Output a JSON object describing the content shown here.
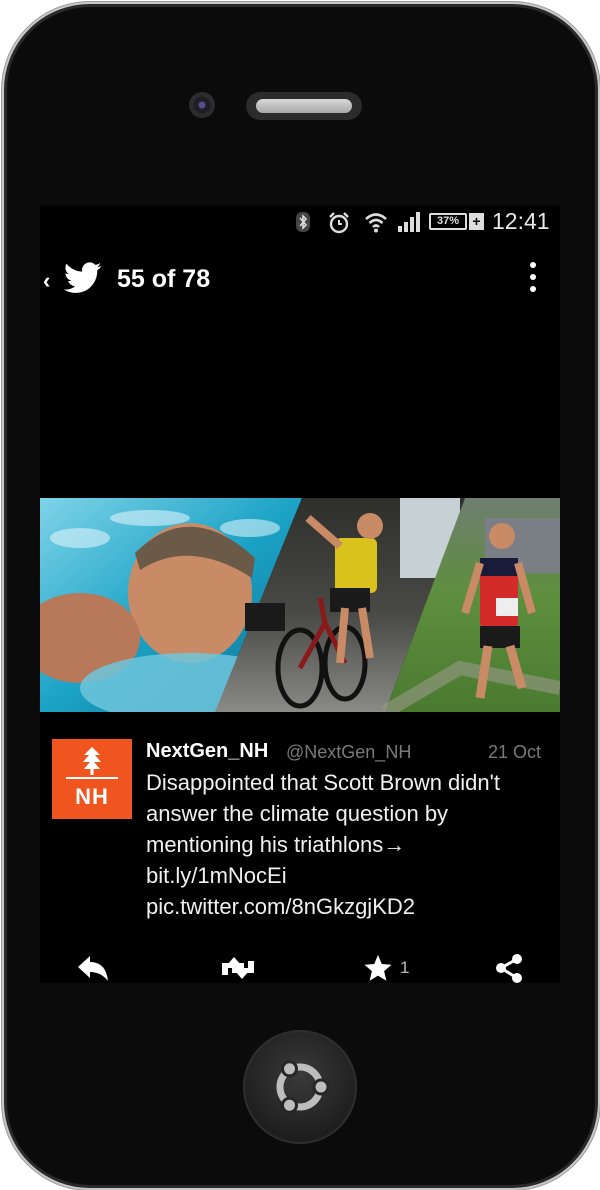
{
  "status_bar": {
    "battery": "37%",
    "battery_plus": "+",
    "time": "12:41",
    "icons": [
      "bluetooth-icon",
      "alarm-icon",
      "wifi-icon",
      "signal-icon",
      "battery-icon"
    ]
  },
  "top_bar": {
    "back": "‹",
    "title": "55 of 78",
    "icons": [
      "back-icon",
      "twitter-bird-icon",
      "overflow-menu-icon"
    ]
  },
  "tweet": {
    "avatar_text": "NH",
    "name": "NextGen_NH",
    "handle": "@NextGen_NH",
    "date": "21 Oct",
    "text_lines": [
      "Disappointed that Scott Brown didn't",
      "answer the climate question by",
      "mentioning his triathlons→",
      "bit.ly/1mNocEi",
      "pic.twitter.com/8nGkzgjKD2"
    ],
    "media_description_icons": [
      "swimming-photo",
      "cycling-photo",
      "running-photo"
    ]
  },
  "actions": {
    "icons": [
      "reply-icon",
      "retweet-icon",
      "favorite-icon",
      "share-icon"
    ],
    "favorite_count": "1"
  },
  "colors": {
    "avatar_bg": "#f0541f",
    "screen_bg": "#000000",
    "handle_gray": "#7a7a7a"
  }
}
